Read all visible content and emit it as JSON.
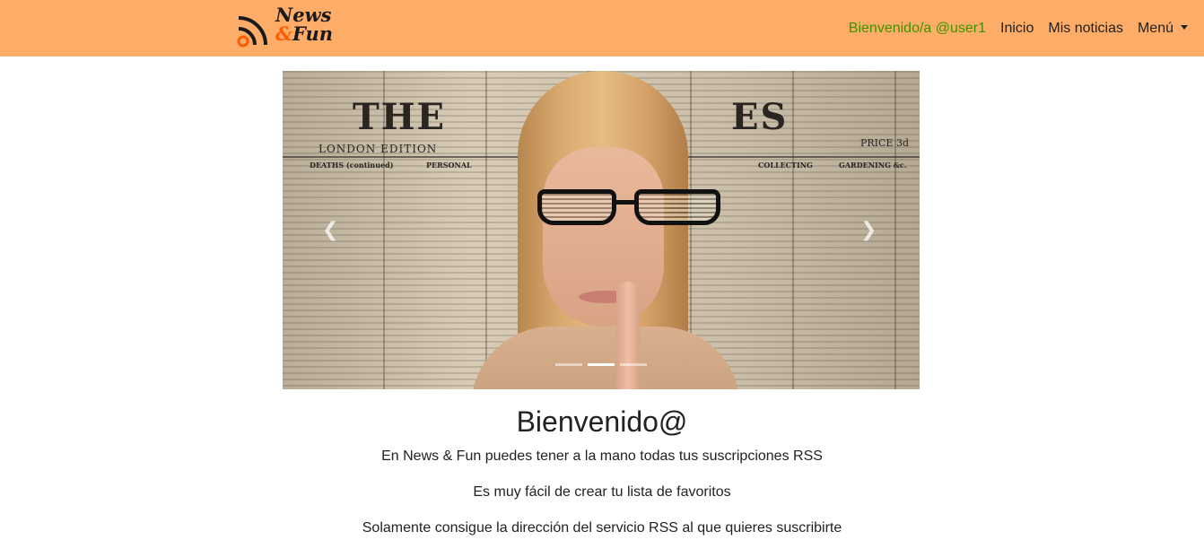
{
  "brand": {
    "line1": "News",
    "amp": "&",
    "line2": "Fun"
  },
  "nav": {
    "welcome": "Bienvenido/a @user1",
    "items": [
      {
        "label": "Inicio"
      },
      {
        "label": "Mis noticias"
      },
      {
        "label": "Menú"
      }
    ]
  },
  "carousel": {
    "masthead_left": "THE",
    "masthead_right": "ES",
    "edition": "LONDON EDITION",
    "price": "PRICE 3d",
    "columns": [
      "DEATHS (continued)",
      "PERSONAL",
      "COLLECTING",
      "GARDENING &c."
    ],
    "slide_count": 3,
    "active_slide": 1,
    "prev_icon": "chevron-left-icon",
    "next_icon": "chevron-right-icon"
  },
  "content": {
    "heading": "Bienvenido@",
    "paragraphs": [
      "En News & Fun puedes tener a la mano todas tus suscripciones RSS",
      "Es muy fácil de crear tu lista de favoritos",
      "Solamente consigue la dirección del servicio RSS al que quieres suscribirte"
    ]
  },
  "colors": {
    "navbar": "#fdad68",
    "welcome": "#3c9500",
    "brand_amp": "#ff5a00"
  }
}
